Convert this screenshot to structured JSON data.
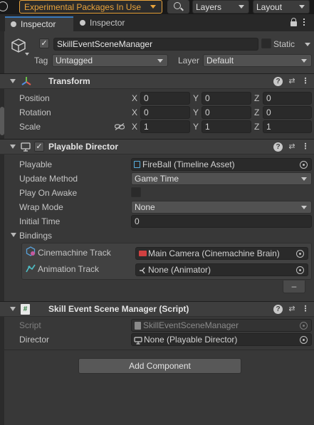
{
  "toolbar": {
    "packages_label": "Experimental Packages In Use",
    "layers_label": "Layers",
    "layout_label": "Layout"
  },
  "tabs": [
    {
      "label": "Inspector"
    },
    {
      "label": "Inspector"
    }
  ],
  "gameobject": {
    "name": "SkillEventSceneManager",
    "static_label": "Static",
    "tag_label": "Tag",
    "tag_value": "Untagged",
    "layer_label": "Layer",
    "layer_value": "Default"
  },
  "transform": {
    "title": "Transform",
    "position_label": "Position",
    "rotation_label": "Rotation",
    "scale_label": "Scale",
    "x": "X",
    "y": "Y",
    "z": "Z",
    "position": [
      "0",
      "0",
      "0"
    ],
    "rotation": [
      "0",
      "0",
      "0"
    ],
    "scale": [
      "1",
      "1",
      "1"
    ]
  },
  "playable_director": {
    "title": "Playable Director",
    "playable_label": "Playable",
    "playable_value": "FireBall (Timeline Asset)",
    "update_method_label": "Update Method",
    "update_method_value": "Game Time",
    "play_on_awake_label": "Play On Awake",
    "wrap_mode_label": "Wrap Mode",
    "wrap_mode_value": "None",
    "initial_time_label": "Initial Time",
    "initial_time_value": "0",
    "bindings_label": "Bindings",
    "bindings": [
      {
        "track": "Cinemachine Track",
        "value": "Main Camera (Cinemachine Brain)"
      },
      {
        "track": "Animation Track",
        "value": "None (Animator)"
      }
    ],
    "remove_label": "–"
  },
  "script_component": {
    "title": "Skill Event Scene Manager (Script)",
    "script_label": "Script",
    "script_value": "SkillEventSceneManager",
    "director_label": "Director",
    "director_value": "None (Playable Director)"
  },
  "add_component_label": "Add Component",
  "colors": {
    "background": "#383838",
    "accent_orange": "#e8a33c",
    "transform_x": "#e05a4e",
    "transform_y": "#6cc24a",
    "transform_z": "#4f8fe0"
  },
  "icons": [
    "history-icon",
    "cloud-icon",
    "search-icon",
    "lock-icon",
    "menu-icon",
    "gameobject-cube-icon",
    "transform-axis-icon",
    "playable-director-icon",
    "script-icon",
    "help-icon",
    "preset-icon",
    "more-icon",
    "link-icon",
    "timeline-asset-icon",
    "camera-icon",
    "animator-icon",
    "object-picker-icon"
  ]
}
